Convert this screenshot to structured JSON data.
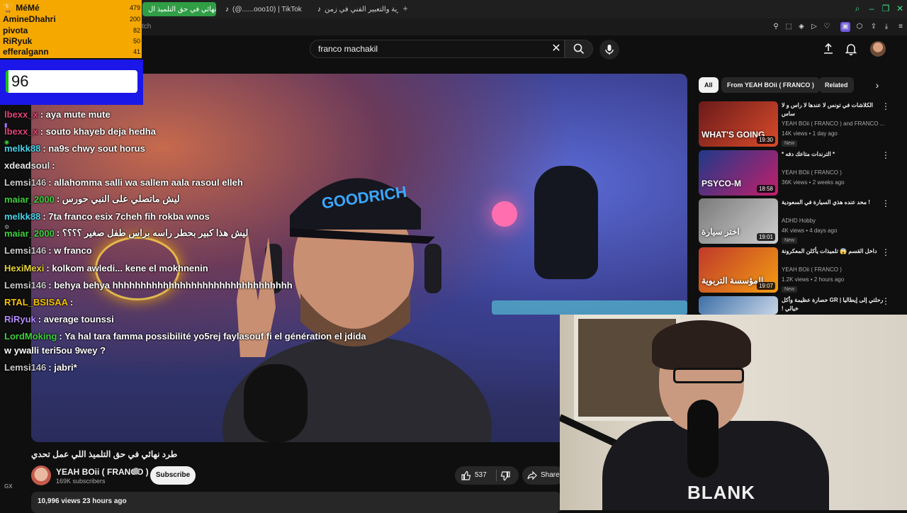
{
  "browser": {
    "tabs": [
      {
        "label": "طرد نهائي في حق التلميذ ال...",
        "active": true
      },
      {
        "label": "(@......ooo10) | TikTok",
        "icon": "tiktok-icon"
      },
      {
        "label": "الحرية والتعبير الفني في زمن...",
        "icon": "tiktok-icon"
      }
    ],
    "url_fragment": "tch"
  },
  "search": {
    "query": "franco machakil"
  },
  "chat_overlay": {
    "leaderboard": [
      {
        "name": "MéMé",
        "score": "479"
      },
      {
        "name": "AmineDhahri",
        "score": "200"
      },
      {
        "name": "pivota",
        "score": "82"
      },
      {
        "name": "RiRyuk",
        "score": "50"
      },
      {
        "name": "efferalgann",
        "score": "41"
      }
    ],
    "counter": "96",
    "messages": [
      {
        "user": "lbexx_x",
        "text": ": aya mute mute",
        "color": "#e0457b"
      },
      {
        "user": "lbexx_x",
        "text": ": souto khayeb deja hedha",
        "color": "#e0457b"
      },
      {
        "user": "melkk88",
        "text": ": na9s chwy sout horus",
        "color": "#4ad2ea"
      },
      {
        "user": "xdeadsoul",
        "text": ":",
        "color": "#e8e8e8"
      },
      {
        "user": "Lemsi146",
        "text": ": allahomma salli wa sallem aala rasoul elleh",
        "color": "#c9c9c9"
      },
      {
        "user": "maiar_2000",
        "text": ": ليش ماتصلي على النبي حورس",
        "color": "#3ecf3e"
      },
      {
        "user": "melkk88",
        "text": ": 7ta franco esix 7cheh fih rokba wnos",
        "color": "#4ad2ea"
      },
      {
        "user": "maiar_2000",
        "text": ": ليش هذا كبير بحطر راسه براس طفل صغير ؟؟؟؟",
        "color": "#3ecf3e"
      },
      {
        "user": "Lemsi146",
        "text": ": w franco",
        "color": "#c9c9c9"
      },
      {
        "user": "HexiMexi",
        "text": ": kolkom awledi... kene el mokhnenin",
        "color": "#e3d23a"
      },
      {
        "user": "Lemsi146",
        "text": ": behya behya hhhhhhhhhhhhhhhhhhhhhhhhhhhhhhhh",
        "color": "#c9c9c9"
      },
      {
        "user": "RTAL_BSISAA",
        "text": ":",
        "color": "#f5c400"
      },
      {
        "user": "RiRyuk",
        "text": ": average tounssi",
        "color": "#b48cff"
      },
      {
        "user": "LordMoking",
        "text": ": Ya hal tara famma possibilité yo5rej faylasouf fi el génération el jdida",
        "color": "#3ecf3e"
      },
      {
        "user": "",
        "text": "w ywalli teri5ou 9wey ?",
        "color": "#ffffff"
      },
      {
        "user": "Lemsi146",
        "text": ": jabri*",
        "color": "#c9c9c9"
      }
    ]
  },
  "video": {
    "title": "طرد نهائي في حق التلميذ اللي عمل تحدي",
    "channel": "YEAH BOii ( FRANCO )",
    "subscribers": "169K subscribers",
    "subscribe_label": "Subscribe",
    "likes": "537",
    "share_label": "Share",
    "meta": "10,996 views  23 hours ago"
  },
  "filters": [
    "All",
    "From YEAH BOii ( FRANCO )",
    "Related"
  ],
  "recommendations": [
    {
      "title": "الكلاشات في تونس لا عندها لا راس و لا ساس",
      "channel": "YEAH BOii ( FRANCO ) and FRANCO ...",
      "meta": "14K views • 1 day ago",
      "badge": "New",
      "duration": "19:30",
      "thumb_text": "WHAT'S GOING",
      "thumb_colors": [
        "#6b1a1a",
        "#d84b2a"
      ]
    },
    {
      "title": "* الترندات متاعك دفه *",
      "channel": "YEAH BOii ( FRANCO )",
      "meta": "36K views • 2 weeks ago",
      "badge": "",
      "duration": "18:58",
      "thumb_text": "PSYCO-M",
      "thumb_colors": [
        "#1f3a8a",
        "#c21f6a"
      ]
    },
    {
      "title": "! محد عنده هذي السيارة في السعودية",
      "channel": "ADHD Hobby",
      "meta": "4K views • 4 days ago",
      "badge": "New",
      "duration": "19:01",
      "thumb_text": "اختر سيارة",
      "thumb_colors": [
        "#7a7a7a",
        "#cfcfcf"
      ]
    },
    {
      "title": "داخل القسم 😱 تلميذات يأكلن المعكرونة",
      "channel": "YEAH BOii ( FRANCO )",
      "meta": "1.2K views • 2 hours ago",
      "badge": "New",
      "duration": "19:07",
      "thumb_text": "المؤسسة التربوية",
      "thumb_colors": [
        "#c0392b",
        "#f39c12"
      ]
    },
    {
      "title": "رحلتي إلى إيطاليا | GR حصارة عظيمة وأكل خيالي !",
      "channel": "",
      "meta": "",
      "badge": "",
      "duration": "",
      "thumb_text": "",
      "thumb_colors": [
        "#3d6fa8",
        "#c9d6e6"
      ]
    }
  ],
  "webcam": {
    "shirt_text": "BLANK"
  },
  "side_icon": "GX"
}
